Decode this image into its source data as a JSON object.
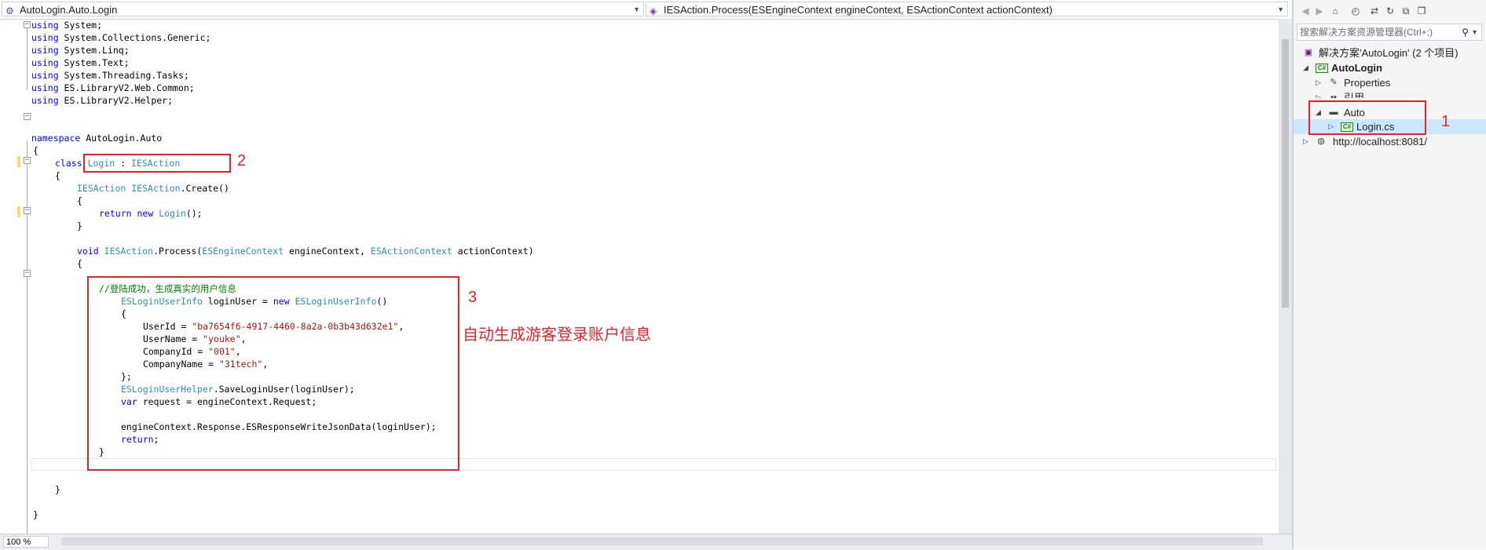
{
  "nav": {
    "class_combo": "AutoLogin.Auto.Login",
    "member_combo": "IESAction.Process(ESEngineContext engineContext, ESActionContext actionContext)"
  },
  "code": {
    "l1": [
      "using",
      " System;"
    ],
    "l2": [
      "using",
      " System.Collections.Generic;"
    ],
    "l3": [
      "using",
      " System.Linq;"
    ],
    "l4": [
      "using",
      " System.Text;"
    ],
    "l5": [
      "using",
      " System.Threading.Tasks;"
    ],
    "l6": [
      "using",
      " ES.LibraryV2.Web.Common;"
    ],
    "l7": [
      "using",
      " ES.LibraryV2.Helper;"
    ],
    "ns_kw": "namespace",
    "ns_name": " AutoLogin.Auto",
    "brace_open": "{",
    "brace_close": "}",
    "class_kw": "class",
    "class_name": "Login",
    "class_colon": " : ",
    "iface": "IESAction",
    "create_iface": "IESAction",
    "create_iface2": "IESAction",
    "create_tail": ".Create()",
    "return_kw": "return",
    "new_kw": "new",
    "return_type": "Login",
    "return_tail": "();",
    "void_kw": "void",
    "proc_iface": "IESAction",
    "proc_mid": ".Process(",
    "ctx1_type": "ESEngineContext",
    "ctx1_name": " engineContext, ",
    "ctx2_type": "ESActionContext",
    "ctx2_name": " actionContext)",
    "comment": "//登陆成功，生成真实的用户信息",
    "uinfo_type": "ESLoginUserInfo",
    "uinfo_mid": " loginUser = ",
    "uinfo_new": "new",
    "uinfo_type2": "ESLoginUserInfo",
    "uinfo_tail": "()",
    "userid_key": "UserId = ",
    "userid_val": "\"ba7654f6-4917-4460-8a2a-0b3b43d632e1\"",
    "username_key": "UserName = ",
    "username_val": "\"youke\"",
    "companyid_key": "CompanyId = ",
    "companyid_val": "\"001\"",
    "companyname_key": "CompanyName = ",
    "companyname_val": "\"31tech\"",
    "comma": ",",
    "obj_close": "};",
    "helper_type": "ESLoginUserHelper",
    "helper_tail": ".SaveLoginUser(loginUser);",
    "var_kw": "var",
    "var_tail": " request = engineContext.Request;",
    "write_line": "engineContext.Response.ESResponseWriteJsonData(loginUser);",
    "return2_kw": "return",
    "return2_tail": ";"
  },
  "annotations": {
    "n1": "1",
    "n2": "2",
    "n3": "3",
    "caption": "自动生成游客登录账户信息"
  },
  "zoom": "100 %",
  "solution_explorer": {
    "search_placeholder": "搜索解决方案资源管理器(Ctrl+;)",
    "nodes": {
      "solution": "解决方案'AutoLogin' (2 个项目)",
      "project": "AutoLogin",
      "properties": "Properties",
      "references": "引用",
      "auto_folder": "Auto",
      "login_file": "Login.cs",
      "website": "http://localhost:8081/"
    }
  },
  "colors": {
    "keyword": "#0000ff",
    "type": "#2b91af",
    "string": "#a31515",
    "comment": "#008000",
    "annotation": "#e8212e",
    "selection": "#cce8ff"
  }
}
